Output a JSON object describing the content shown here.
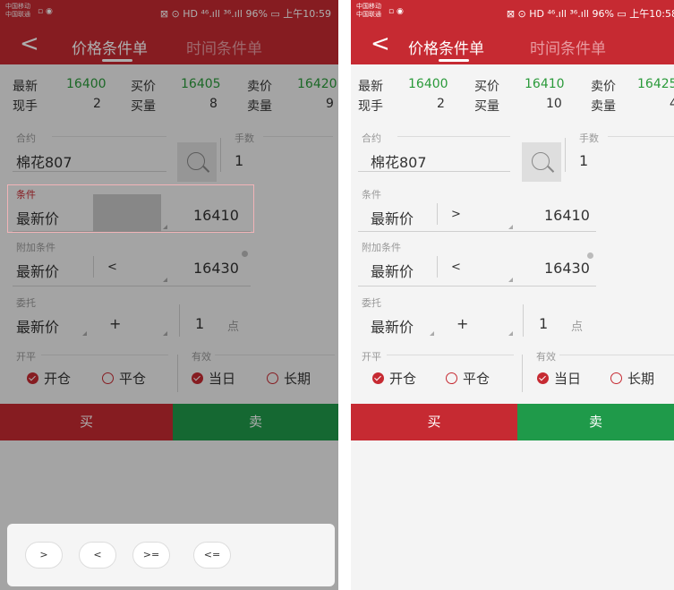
{
  "screens": [
    {
      "status": {
        "carrier1": "中国移动",
        "carrier2": "中国联通",
        "right": "⊠ ⊙ HD ⁴⁶.ıll ³⁶.ıll 96% ▭ 上午10:59"
      },
      "nav": {
        "back": "<",
        "tab_price": "价格条件单",
        "tab_time": "时间条件单"
      },
      "quote": {
        "latest_label": "最新",
        "latest": "16400",
        "bid_label": "买价",
        "bid": "16405",
        "ask_label": "卖价",
        "ask": "16420",
        "hand_label": "现手",
        "hand": "2",
        "bidvol_label": "买量",
        "bidvol": "8",
        "askvol_label": "卖量",
        "askvol": "9"
      },
      "contract": {
        "label": "合约",
        "value": "棉花807"
      },
      "lots": {
        "label": "手数",
        "value": "1"
      },
      "condition": {
        "label": "条件",
        "field": "最新价",
        "op": ">",
        "price": "16410"
      },
      "extra": {
        "label": "附加条件",
        "field": "最新价",
        "op": "<",
        "price": "16430"
      },
      "order": {
        "label": "委托",
        "field": "最新价",
        "op": "+",
        "ticks": "1",
        "unit": "点"
      },
      "openclose": {
        "label": "开平",
        "open": "开仓",
        "close": "平仓"
      },
      "validity": {
        "label": "有效",
        "today": "当日",
        "long": "长期"
      },
      "buy": "买",
      "sell": "卖",
      "keys": [
        ">",
        "<",
        ">=",
        "<="
      ]
    },
    {
      "status": {
        "carrier1": "中国移动",
        "carrier2": "中国联通",
        "right": "⊠ ⊙ HD ⁴⁶.ıll ³⁶.ıll 96% ▭ 上午10:58"
      },
      "nav": {
        "back": "<",
        "tab_price": "价格条件单",
        "tab_time": "时间条件单"
      },
      "quote": {
        "latest_label": "最新",
        "latest": "16400",
        "bid_label": "买价",
        "bid": "16410",
        "ask_label": "卖价",
        "ask": "16425",
        "hand_label": "现手",
        "hand": "2",
        "bidvol_label": "买量",
        "bidvol": "10",
        "askvol_label": "卖量",
        "askvol": "4"
      },
      "contract": {
        "label": "合约",
        "value": "棉花807"
      },
      "lots": {
        "label": "手数",
        "value": "1"
      },
      "condition": {
        "label": "条件",
        "field": "最新价",
        "op": ">",
        "price": "16410"
      },
      "extra": {
        "label": "附加条件",
        "field": "最新价",
        "op": "<",
        "price": "16430"
      },
      "order": {
        "label": "委托",
        "field": "最新价",
        "op": "+",
        "ticks": "1",
        "unit": "点"
      },
      "openclose": {
        "label": "开平",
        "open": "开仓",
        "close": "平仓"
      },
      "validity": {
        "label": "有效",
        "today": "当日",
        "long": "长期"
      },
      "buy": "买",
      "sell": "卖"
    }
  ],
  "colors": {
    "brand_red": "#c62a32",
    "sell_green": "#1f9a4a",
    "price_green": "#2a9a3a"
  }
}
